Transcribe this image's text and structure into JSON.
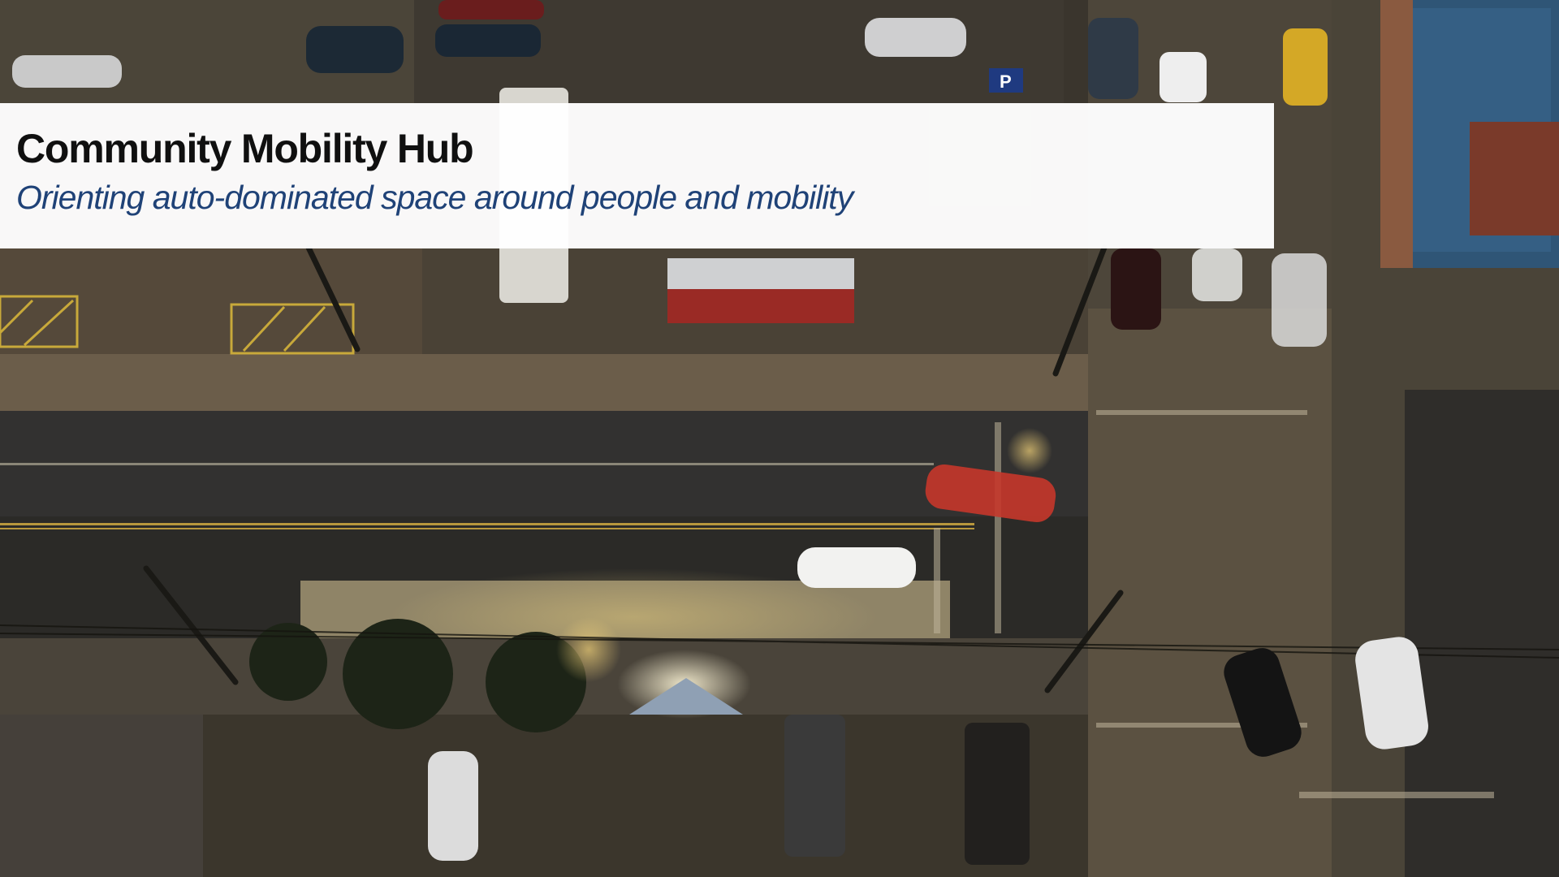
{
  "slide": {
    "title": "Community Mobility Hub",
    "subtitle": "Orienting auto-dominated space around people and mobility"
  },
  "photo": {
    "description": "aerial-night-street-intersection",
    "parking_sign": "P"
  },
  "colors": {
    "banner_background": "#ffffff",
    "title_text": "#101010",
    "subtitle_text": "#1f4277"
  }
}
